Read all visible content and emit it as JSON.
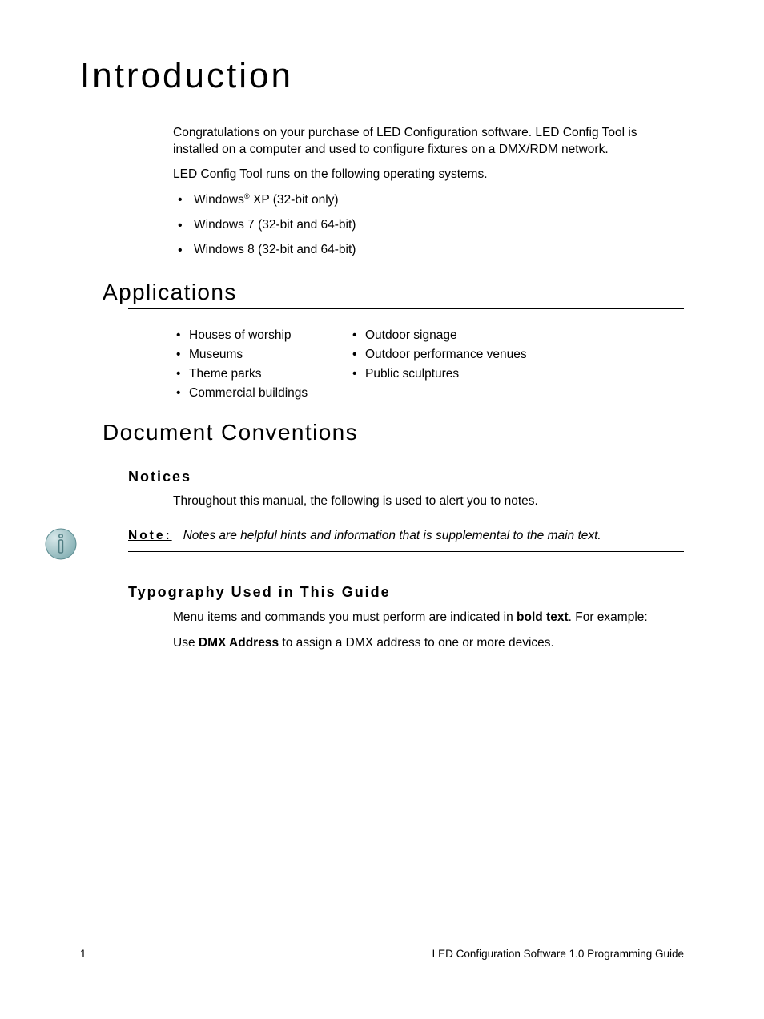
{
  "title": "Introduction",
  "intro": {
    "p1": "Congratulations on your purchase of LED Configuration software. LED Config Tool is installed on a computer and used to configure fixtures on a DMX/RDM network.",
    "p2": "LED Config Tool runs on the following operating systems.",
    "os": {
      "i0_pre": "Windows",
      "i0_reg": "®",
      "i0_post": " XP (32-bit only)",
      "i1": "Windows 7 (32-bit and 64-bit)",
      "i2": "Windows 8 (32-bit and 64-bit)"
    }
  },
  "applications": {
    "heading": "Applications",
    "col1": {
      "i0": "Houses of worship",
      "i1": "Museums",
      "i2": "Theme parks",
      "i3": "Commercial buildings"
    },
    "col2": {
      "i0": "Outdoor signage",
      "i1": "Outdoor performance venues",
      "i2": "Public sculptures"
    }
  },
  "conventions": {
    "heading": "Document Conventions",
    "notices_heading": "Notices",
    "notices_text": "Throughout this manual, the following is used to alert you to notes.",
    "note_label": "Note:",
    "note_text": "Notes are helpful hints and information that is supplemental to the main text.",
    "typo_heading": "Typography Used in This Guide",
    "typo_p1_pre": "Menu items and commands you must perform are indicated in ",
    "typo_p1_bold": "bold text",
    "typo_p1_post": ". For example:",
    "typo_p2_pre": "Use ",
    "typo_p2_bold": "DMX Address",
    "typo_p2_post": " to assign a DMX address to one or more devices."
  },
  "footer": {
    "page": "1",
    "label": "LED Configuration Software 1.0 Programming Guide"
  }
}
